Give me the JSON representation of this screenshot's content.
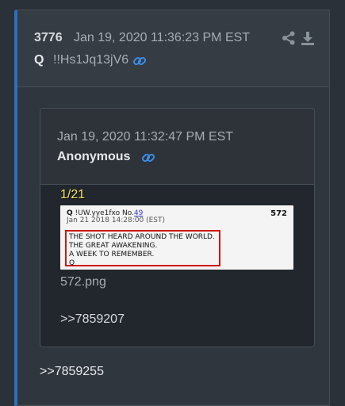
{
  "post": {
    "number": "3776",
    "timestamp": "Jan 19, 2020 11:36:23 PM EST",
    "name": "Q",
    "tripcode": "!!Hs1Jq13jV6",
    "reply_ref": ">>7859255"
  },
  "quoted_post": {
    "timestamp": "Jan 19, 2020 11:32:47 PM EST",
    "name": "Anonymous",
    "image_counter": "1/21",
    "filename": "572.png",
    "reply_ref": ">>7859207",
    "image": {
      "poster": "Q",
      "trip": "!UW.yye1fxo",
      "no_label": "No.",
      "no_link": "49",
      "date": "Jan 21 2018 14:28:00 (EST)",
      "post_num": "572",
      "lines": [
        "THE SHOT HEARD AROUND THE WORLD.",
        "THE GREAT AWAKENING.",
        "A WEEK TO REMEMBER.",
        "Q"
      ]
    }
  },
  "colors": {
    "accent": "#2e6fc0",
    "link_icon": "#3b8ee8",
    "counter": "#f5e96a",
    "highlight_box": "#d01818"
  },
  "icons": [
    "share-icon",
    "download-icon",
    "link-icon"
  ]
}
